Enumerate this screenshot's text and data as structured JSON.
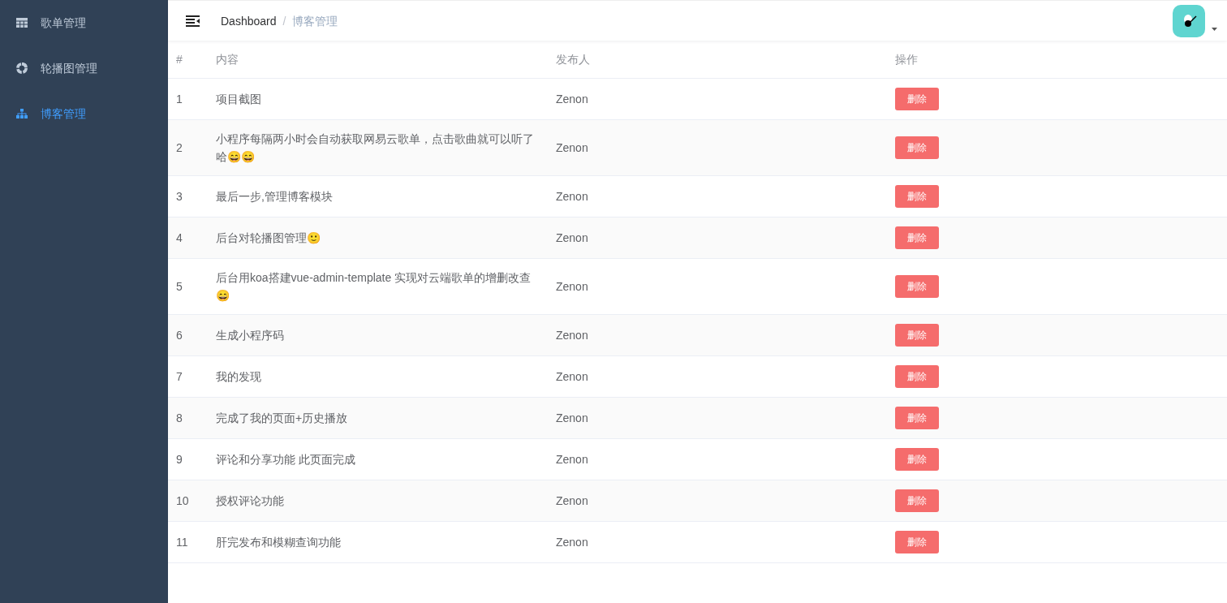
{
  "sidebar": {
    "items": [
      {
        "label": "歌单管理",
        "kind": "grid",
        "selected": false
      },
      {
        "label": "轮播图管理",
        "kind": "ring",
        "selected": false
      },
      {
        "label": "博客管理",
        "kind": "tree",
        "selected": true
      }
    ]
  },
  "breadcrumb": {
    "items": [
      "Dashboard",
      "博客管理"
    ],
    "separator": "/"
  },
  "table": {
    "columns": [
      "#",
      "内容",
      "发布人",
      "操作"
    ],
    "rows": [
      {
        "index": "1",
        "content": "项目截图",
        "author": "Zenon",
        "action": "删除"
      },
      {
        "index": "2",
        "content": "小程序每隔两小时会自动获取网易云歌单，点击歌曲就可以听了哈😄😄",
        "author": "Zenon",
        "action": "删除"
      },
      {
        "index": "3",
        "content": "最后一步,管理博客模块",
        "author": "Zenon",
        "action": "删除"
      },
      {
        "index": "4",
        "content": "后台对轮播图管理🙂",
        "author": "Zenon",
        "action": "删除"
      },
      {
        "index": "5",
        "content": "后台用koa搭建vue-admin-template 实现对云端歌单的增删改查😄",
        "author": "Zenon",
        "action": "删除"
      },
      {
        "index": "6",
        "content": "生成小程序码",
        "author": "Zenon",
        "action": "删除"
      },
      {
        "index": "7",
        "content": "我的发现",
        "author": "Zenon",
        "action": "删除"
      },
      {
        "index": "8",
        "content": "完成了我的页面+历史播放",
        "author": "Zenon",
        "action": "删除"
      },
      {
        "index": "9",
        "content": "评论和分享功能 此页面完成",
        "author": "Zenon",
        "action": "删除"
      },
      {
        "index": "10",
        "content": "授权评论功能",
        "author": "Zenon",
        "action": "删除"
      },
      {
        "index": "11",
        "content": "肝完发布和模糊查询功能",
        "author": "Zenon",
        "action": "删除"
      }
    ]
  }
}
